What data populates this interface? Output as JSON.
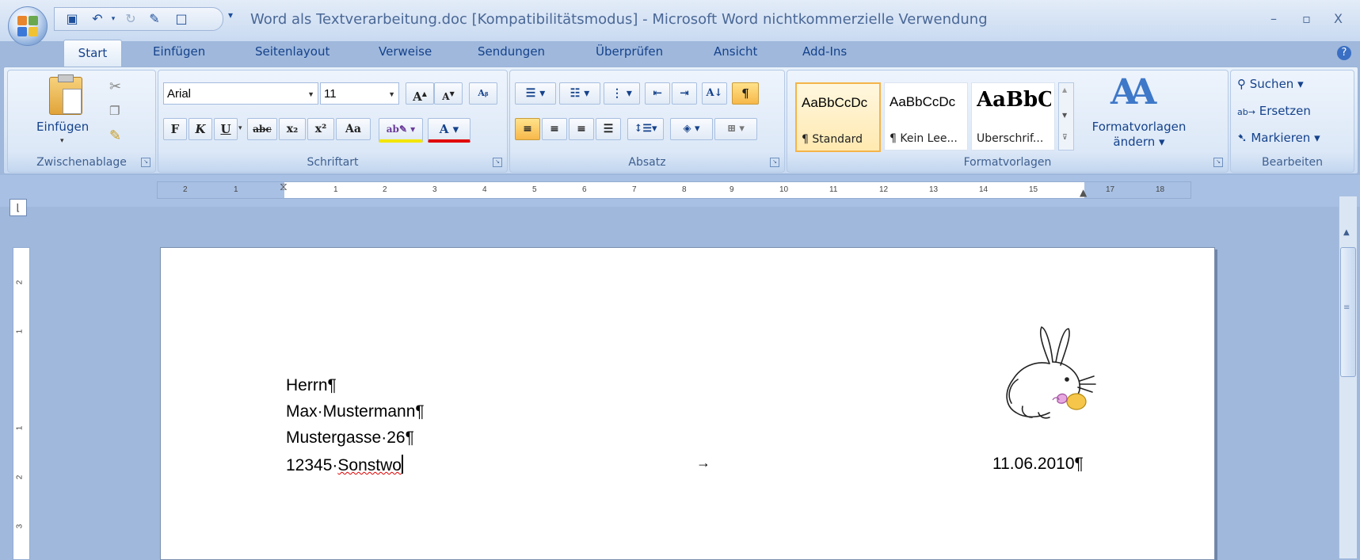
{
  "window": {
    "title": "Word als Textverarbeitung.doc [Kompatibilitätsmodus] - Microsoft Word nichtkommerzielle Verwendung",
    "minimize": "–",
    "maximize": "▫",
    "close": "X"
  },
  "tabs": [
    "Start",
    "Einfügen",
    "Seitenlayout",
    "Verweise",
    "Sendungen",
    "Überprüfen",
    "Ansicht",
    "Add-Ins"
  ],
  "ribbon": {
    "clipboard": {
      "paste_label": "Einfügen",
      "group_label": "Zwischenablage"
    },
    "font": {
      "name": "Arial",
      "size": "11",
      "group_label": "Schriftart",
      "bold": "F",
      "italic": "K",
      "underline": "U",
      "strike": "abc",
      "subscript": "x₂",
      "superscript": "x²",
      "case": "Aa"
    },
    "paragraph": {
      "group_label": "Absatz",
      "pilcrow": "¶"
    },
    "styles": {
      "group_label": "Formatvorlagen",
      "tiles": [
        {
          "sample": "AaBbCcDc",
          "name": "¶ Standard"
        },
        {
          "sample": "AaBbCcDc",
          "name": "¶ Kein Lee..."
        },
        {
          "sample": "AaBbC",
          "name": "Überschrif..."
        }
      ],
      "change_styles": "Formatvorlagen ändern"
    },
    "editing": {
      "group_label": "Bearbeiten",
      "find": "Suchen",
      "replace": "Ersetzen",
      "select": "Markieren"
    }
  },
  "ruler": {
    "ticks": [
      "2",
      "1",
      "1",
      "2",
      "3",
      "4",
      "5",
      "6",
      "7",
      "8",
      "9",
      "10",
      "11",
      "12",
      "13",
      "14",
      "15",
      "17",
      "18"
    ]
  },
  "vruler": {
    "ticks": [
      "2",
      "1",
      "1",
      "2",
      "3"
    ]
  },
  "document": {
    "address": [
      "Herrn¶",
      "Max·Mustermann¶",
      "Mustergasse·26¶"
    ],
    "zip_line_number": "12345·",
    "zip_line_city": "Sonstwo",
    "tab_arrow": "→",
    "date": "11.06.2010¶"
  },
  "colors": {
    "accent": "#15428b",
    "ribbon": "#dbe7f6"
  }
}
